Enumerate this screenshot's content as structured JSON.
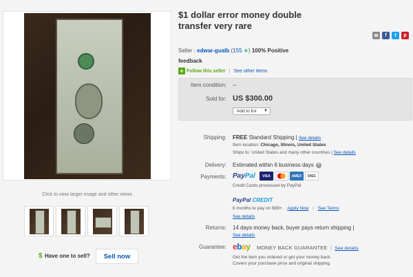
{
  "listing": {
    "title": "$1 dollar error money double transfer very rare"
  },
  "photos": {
    "caption": "Click to view larger image and other views",
    "thumbnails": [
      "thumb-1",
      "thumb-2",
      "thumb-3",
      "thumb-4"
    ]
  },
  "sell": {
    "dollar": "$",
    "prompt": "Have one to sell?",
    "button": "Sell now"
  },
  "share_icons": [
    "email-icon",
    "facebook-icon",
    "twitter-icon",
    "pinterest-icon"
  ],
  "seller": {
    "label": "Seller :",
    "name": "edwar-gualb",
    "score": "155",
    "positive": "100% Positive",
    "feedback": "feedback",
    "follow": "Follow this seller",
    "other_items": "See other items"
  },
  "item": {
    "condition_label": "Item condition:",
    "condition_value": "--",
    "sold_for_label": "Sold for:",
    "price": "US $300.00",
    "add_to_list": "Add to list"
  },
  "shipping": {
    "label": "Shipping:",
    "free": "FREE",
    "method": "Standard Shipping |",
    "see_details": "See details",
    "location_label": "Item location:",
    "location": "Chicago, Illinois, United States",
    "ships_to_label": "Ships to:",
    "ships_to": "United States and many other countries |",
    "ships_see_details": "See details"
  },
  "delivery": {
    "label": "Delivery:",
    "value": "Estimated within 6 business days"
  },
  "payments": {
    "label": "Payments:",
    "paypal_1": "Pay",
    "paypal_2": "Pal",
    "cards": [
      "VISA",
      "MC",
      "AMEX",
      "DISCOVER"
    ],
    "note": "Credit Cards processed by PayPal",
    "credit_1": "PayPal",
    "credit_2": "CREDIT",
    "months": "6 months to pay on $99+.",
    "apply": "Apply Now",
    "see_terms": "See Terms",
    "see_details": "See details"
  },
  "returns": {
    "label": "Returns:",
    "value": "14 days money back, buyer pays return shipping |",
    "see_details": "See details"
  },
  "guarantee": {
    "label": "Guarantee:",
    "ebay_e": "e",
    "ebay_b": "b",
    "ebay_a": "a",
    "ebay_y": "y",
    "mbg": "MONEY BACK GUARANTEE",
    "see_details": "See details",
    "note1": "Get the item you ordered or get your money back.",
    "note2": "Covers your purchase price and original shipping."
  },
  "colors": {
    "link": "#0654ba",
    "green": "#5ba71b",
    "price_box": "#e4e4e4"
  }
}
